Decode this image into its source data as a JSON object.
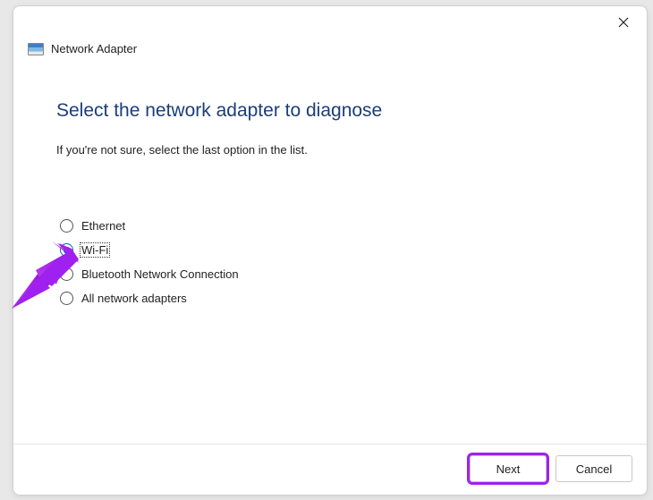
{
  "window": {
    "title": "Network Adapter"
  },
  "main": {
    "heading": "Select the network adapter to diagnose",
    "subtitle": "If you're not sure, select the last option in the list."
  },
  "options": [
    {
      "label": "Ethernet",
      "selected": false
    },
    {
      "label": "Wi-Fi",
      "selected": true
    },
    {
      "label": "Bluetooth Network Connection",
      "selected": false
    },
    {
      "label": "All network adapters",
      "selected": false
    }
  ],
  "footer": {
    "next": "Next",
    "cancel": "Cancel"
  }
}
